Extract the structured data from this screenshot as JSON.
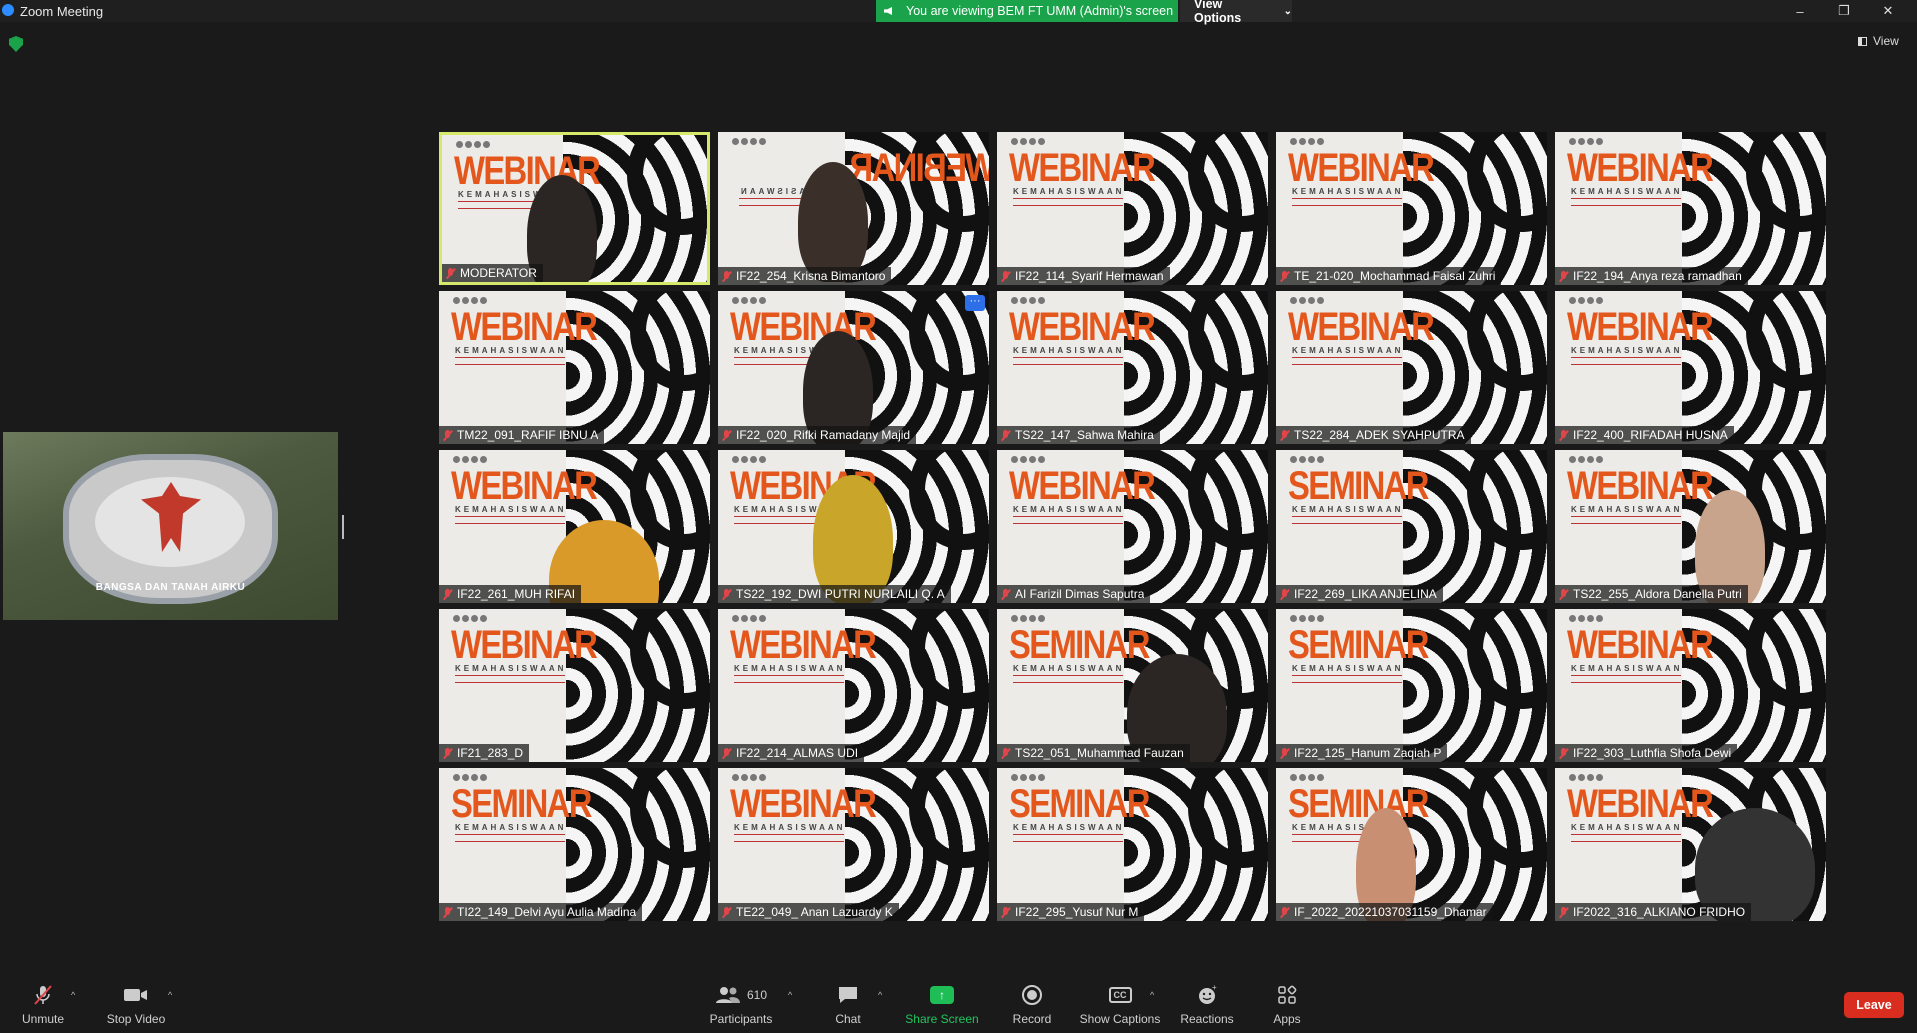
{
  "window": {
    "title": "Zoom Meeting",
    "share_banner": "You are viewing BEM FT UMM (Admin)'s screen",
    "view_options": "View Options",
    "view_button": "View",
    "controls": {
      "minimize": "–",
      "maximize": "❐",
      "close": "✕"
    }
  },
  "shared_screen": {
    "caption": "BANGSA DAN TANAH AIRKU"
  },
  "participants": [
    {
      "name": "MODERATOR",
      "poster": "WEBINAR",
      "active": true,
      "video": "person"
    },
    {
      "name": "IF22_254_Krisna Bimantoro",
      "poster": "WEBINAR",
      "mirrored": true,
      "video": "person"
    },
    {
      "name": "IF22_114_Syarif Hermawan",
      "poster": "WEBINAR"
    },
    {
      "name": "TE_21-020_Mochammad Faisal Zuhri",
      "poster": "WEBINAR"
    },
    {
      "name": "IF22_194_Anya reza ramadhan",
      "poster": "WEBINAR"
    },
    {
      "name": "TM22_091_RAFIF IBNU A",
      "poster": "WEBINAR"
    },
    {
      "name": "IF22_020_Rifki Ramadany Majid",
      "poster": "WEBINAR",
      "video": "person",
      "more": "···"
    },
    {
      "name": "TS22_147_Sahwa Mahira",
      "poster": "WEBINAR"
    },
    {
      "name": "TS22_284_ADEK SYAHPUTRA",
      "poster": "WEBINAR"
    },
    {
      "name": "IF22_400_RIFADAH HUSNA",
      "poster": "WEBINAR"
    },
    {
      "name": "IF22_261_MUH RIFAI",
      "poster": "WEBINAR",
      "video": "person"
    },
    {
      "name": "TS22_192_DWI PUTRI NURLAILI Q. A",
      "poster": "WEBINAR",
      "video": "avatar"
    },
    {
      "name": "AI Farizil Dimas Saputra",
      "poster": "WEBINAR"
    },
    {
      "name": "IF22_269_LIKA ANJELINA",
      "poster": "SEMINAR"
    },
    {
      "name": "TS22_255_Aldora Danella Putri",
      "poster": "WEBINAR",
      "video": "person"
    },
    {
      "name": "IF21_283_D",
      "poster": "WEBINAR"
    },
    {
      "name": "IF22_214_ALMAS UDI",
      "poster": "WEBINAR"
    },
    {
      "name": "TS22_051_Muhammad Fauzan",
      "poster": "SEMINAR",
      "video": "person"
    },
    {
      "name": "IF22_125_Hanum Zaqiah P",
      "poster": "SEMINAR"
    },
    {
      "name": "IF22_303_Luthfia Shofa Dewi",
      "poster": "WEBINAR"
    },
    {
      "name": "TI22_149_Delvi Ayu Aulia Madina",
      "poster": "SEMINAR"
    },
    {
      "name": "TE22_049_ Anan Lazuardy K",
      "poster": "WEBINAR"
    },
    {
      "name": "IF22_295_Yusuf Nur M",
      "poster": "SEMINAR"
    },
    {
      "name": "IF_2022_20221037031159_Dhamar",
      "poster": "SEMINAR",
      "video": "person"
    },
    {
      "name": "IF2022_316_ALKIANO FRIDHO",
      "poster": "WEBINAR",
      "video": "person"
    }
  ],
  "poster_subtitle": "KEMAHASISWAAN",
  "toolbar": {
    "unmute": "Unmute",
    "stop_video": "Stop Video",
    "participants": "Participants",
    "participant_count": "610",
    "chat": "Chat",
    "share_screen": "Share Screen",
    "record": "Record",
    "show_captions": "Show Captions",
    "captions_icon": "CC",
    "reactions": "Reactions",
    "apps": "Apps",
    "leave": "Leave"
  },
  "colors": {
    "share_green": "#1aa34a",
    "active_border": "#d6e96a",
    "poster_orange": "#e4571c",
    "leave_red": "#d92d20",
    "muted_red": "#e0454a"
  }
}
